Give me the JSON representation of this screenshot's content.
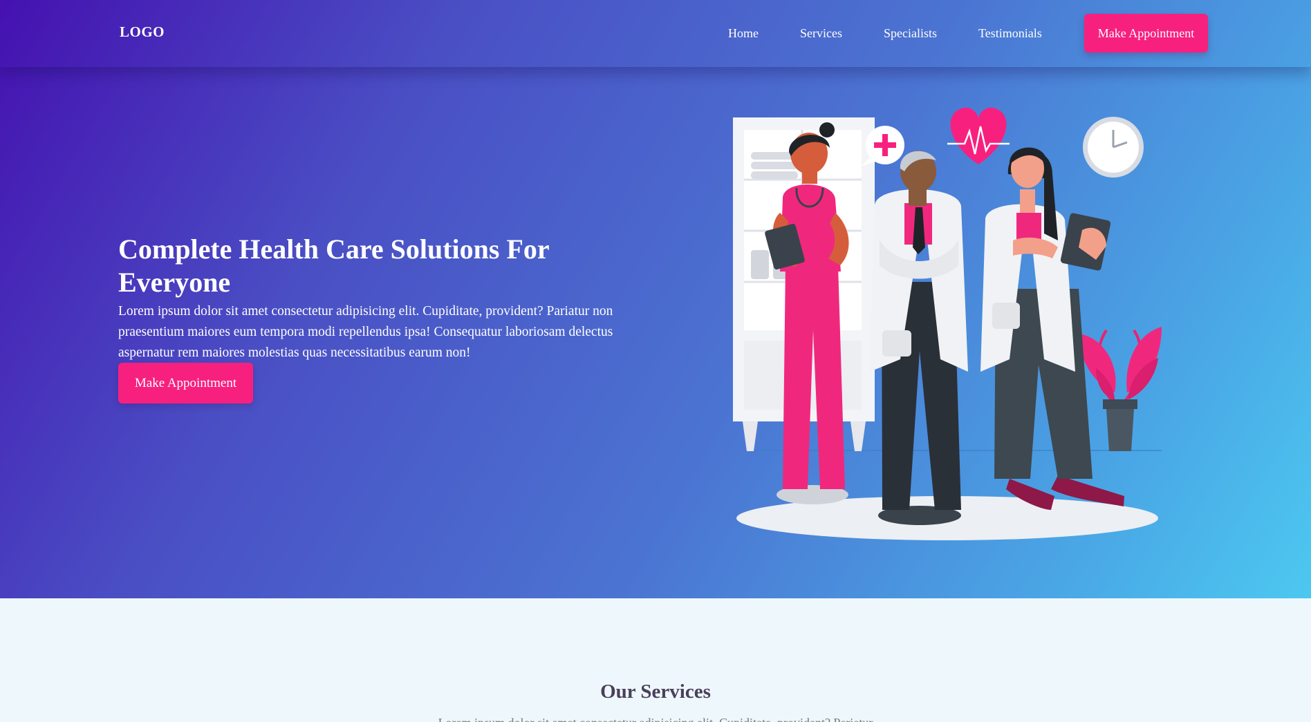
{
  "nav": {
    "logo": "LOGO",
    "links": [
      "Home",
      "Services",
      "Specialists",
      "Testimonials"
    ],
    "cta": "Make Appointment"
  },
  "hero": {
    "title": "Complete Health Care Solutions For Everyone",
    "text": "Lorem ipsum dolor sit amet consectetur adipisicing elit. Cupiditate, provident? Pariatur non praesentium maiores eum tempora modi repellendus ipsa! Consequatur laboriosam delectus aspernatur rem maiores molestias quas necessitatibus earum non!",
    "cta": "Make Appointment"
  },
  "services": {
    "title": "Our Services",
    "subtitle": "Lorem ipsum dolor sit amet consectetur adipisicing elit. Cupiditate, provident? Pariatur"
  },
  "colors": {
    "accent": "#f7207f",
    "gradient_start": "#4511b0",
    "gradient_end": "#4cc8f0",
    "section_bg": "#eef8fc"
  },
  "icons": [
    "plus-bubble-icon",
    "heart-pulse-icon",
    "clock-icon"
  ]
}
